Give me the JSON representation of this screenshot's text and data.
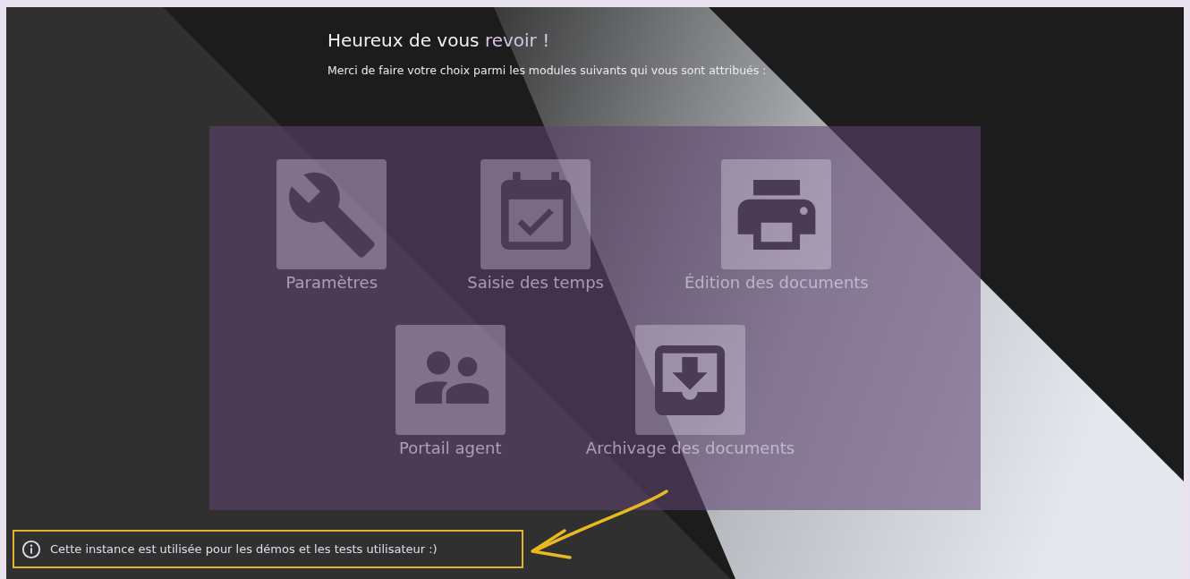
{
  "header": {
    "title": "Heureux de vous",
    "title_accent": "revoir !",
    "subtitle": "Merci de faire votre choix parmi les modules suivants qui vous sont attribués :"
  },
  "modules": [
    [
      {
        "label": "Paramètres"
      },
      {
        "label": "Saisie des temps"
      },
      {
        "label": "Édition des documents"
      }
    ],
    [
      {
        "label": "Portail agent"
      },
      {
        "label": "Archivage des documents"
      }
    ]
  ],
  "notice": {
    "text": "Cette instance est utilisée pour les démos et les tests utilisateur :)"
  }
}
